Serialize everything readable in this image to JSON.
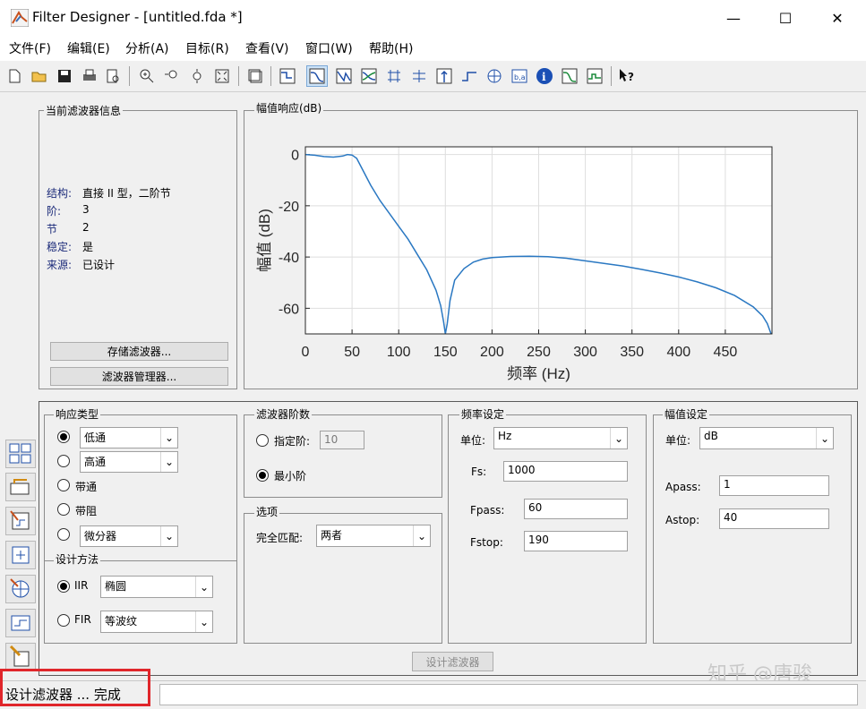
{
  "window": {
    "title": "Filter Designer -  [untitled.fda *]",
    "minimize": "—",
    "maximize": "☐",
    "close": "✕"
  },
  "menu": [
    "文件(F)",
    "编辑(E)",
    "分析(A)",
    "目标(R)",
    "查看(V)",
    "窗口(W)",
    "帮助(H)"
  ],
  "toolbar_icons": [
    "new-file-icon",
    "open-folder-icon",
    "save-icon",
    "print-icon",
    "print-preview-icon",
    "zoom-in-icon",
    "zoom-x-icon",
    "zoom-y-icon",
    "full-view-icon",
    "new-figure-icon",
    "filter-specs-icon",
    "magnitude-response-icon",
    "phase-response-icon",
    "mag-phase-icon",
    "group-delay-icon",
    "phase-delay-icon",
    "impulse-response-icon",
    "step-response-icon",
    "pole-zero-icon",
    "coefficients-icon",
    "info-icon",
    "magnitude-estimate-icon",
    "noise-power-icon",
    "whats-this-icon"
  ],
  "info_panel": {
    "title": "当前滤波器信息",
    "rows": [
      {
        "key": "结构:",
        "value": "直接 II 型，二阶节"
      },
      {
        "key": "阶:",
        "value": "3"
      },
      {
        "key": "节",
        "value": "2"
      },
      {
        "key": "稳定:",
        "value": "是"
      },
      {
        "key": "来源:",
        "value": "已设计"
      }
    ],
    "store_button": "存储滤波器...",
    "manager_button": "滤波器管理器..."
  },
  "plot_panel": {
    "title": "幅值响应(dB)"
  },
  "chart_data": {
    "type": "line",
    "xlabel": "频率 (Hz)",
    "ylabel": "幅值 (dB)",
    "xlim": [
      0,
      500
    ],
    "ylim": [
      -70,
      3
    ],
    "xticks": [
      0,
      50,
      100,
      150,
      200,
      250,
      300,
      350,
      400,
      450
    ],
    "yticks": [
      0,
      -20,
      -40,
      -60
    ],
    "grid": true,
    "color": "#2a78c2",
    "x": [
      0,
      10,
      20,
      30,
      40,
      45,
      50,
      55,
      60,
      70,
      80,
      90,
      100,
      110,
      120,
      130,
      140,
      145,
      148,
      150,
      152,
      155,
      160,
      170,
      180,
      190,
      200,
      220,
      240,
      260,
      280,
      300,
      320,
      340,
      360,
      380,
      400,
      420,
      440,
      460,
      480,
      490,
      495,
      499
    ],
    "y": [
      0,
      -0.3,
      -0.8,
      -1,
      -0.6,
      0,
      -0.2,
      -1.5,
      -5,
      -12,
      -18,
      -23,
      -28,
      -33,
      -39,
      -45,
      -53,
      -59,
      -65,
      -71,
      -66,
      -57,
      -49,
      -44.5,
      -42,
      -40.8,
      -40.2,
      -39.8,
      -39.7,
      -39.9,
      -40.5,
      -41.5,
      -42.5,
      -43.5,
      -44.8,
      -46.2,
      -47.8,
      -49.7,
      -52,
      -55,
      -59.5,
      -63,
      -66,
      -70
    ]
  },
  "response_type": {
    "title": "响应类型",
    "options": [
      {
        "label": "低通",
        "selected": true,
        "dropdown": "低通"
      },
      {
        "label": "高通",
        "selected": false,
        "dropdown": "高通"
      },
      {
        "label": "带通",
        "selected": false
      },
      {
        "label": "带阻",
        "selected": false
      },
      {
        "label": "",
        "selected": false,
        "dropdown": "微分器"
      }
    ]
  },
  "design_method": {
    "title": "设计方法",
    "iir_label": "IIR",
    "iir_value": "椭圆",
    "fir_label": "FIR",
    "fir_value": "等波纹",
    "selected": "IIR"
  },
  "filter_order": {
    "title": "滤波器阶数",
    "specify_label": "指定阶:",
    "specify_value": "10",
    "minimum_label": "最小阶",
    "selected": "minimum"
  },
  "options": {
    "title": "选项",
    "match_label": "完全匹配:",
    "match_value": "两者"
  },
  "freq_spec": {
    "title": "频率设定",
    "unit_label": "单位:",
    "unit_value": "Hz",
    "fs_label": "Fs:",
    "fs_value": "1000",
    "fpass_label": "Fpass:",
    "fpass_value": "60",
    "fstop_label": "Fstop:",
    "fstop_value": "190"
  },
  "mag_spec": {
    "title": "幅值设定",
    "unit_label": "单位:",
    "unit_value": "dB",
    "apass_label": "Apass:",
    "apass_value": "1",
    "astop_label": "Astop:",
    "astop_value": "40"
  },
  "design_button": "设计滤波器",
  "status": "设计滤波器 ... 完成",
  "watermark": "知乎 @唐骏",
  "highlight_color": "#e0262b"
}
